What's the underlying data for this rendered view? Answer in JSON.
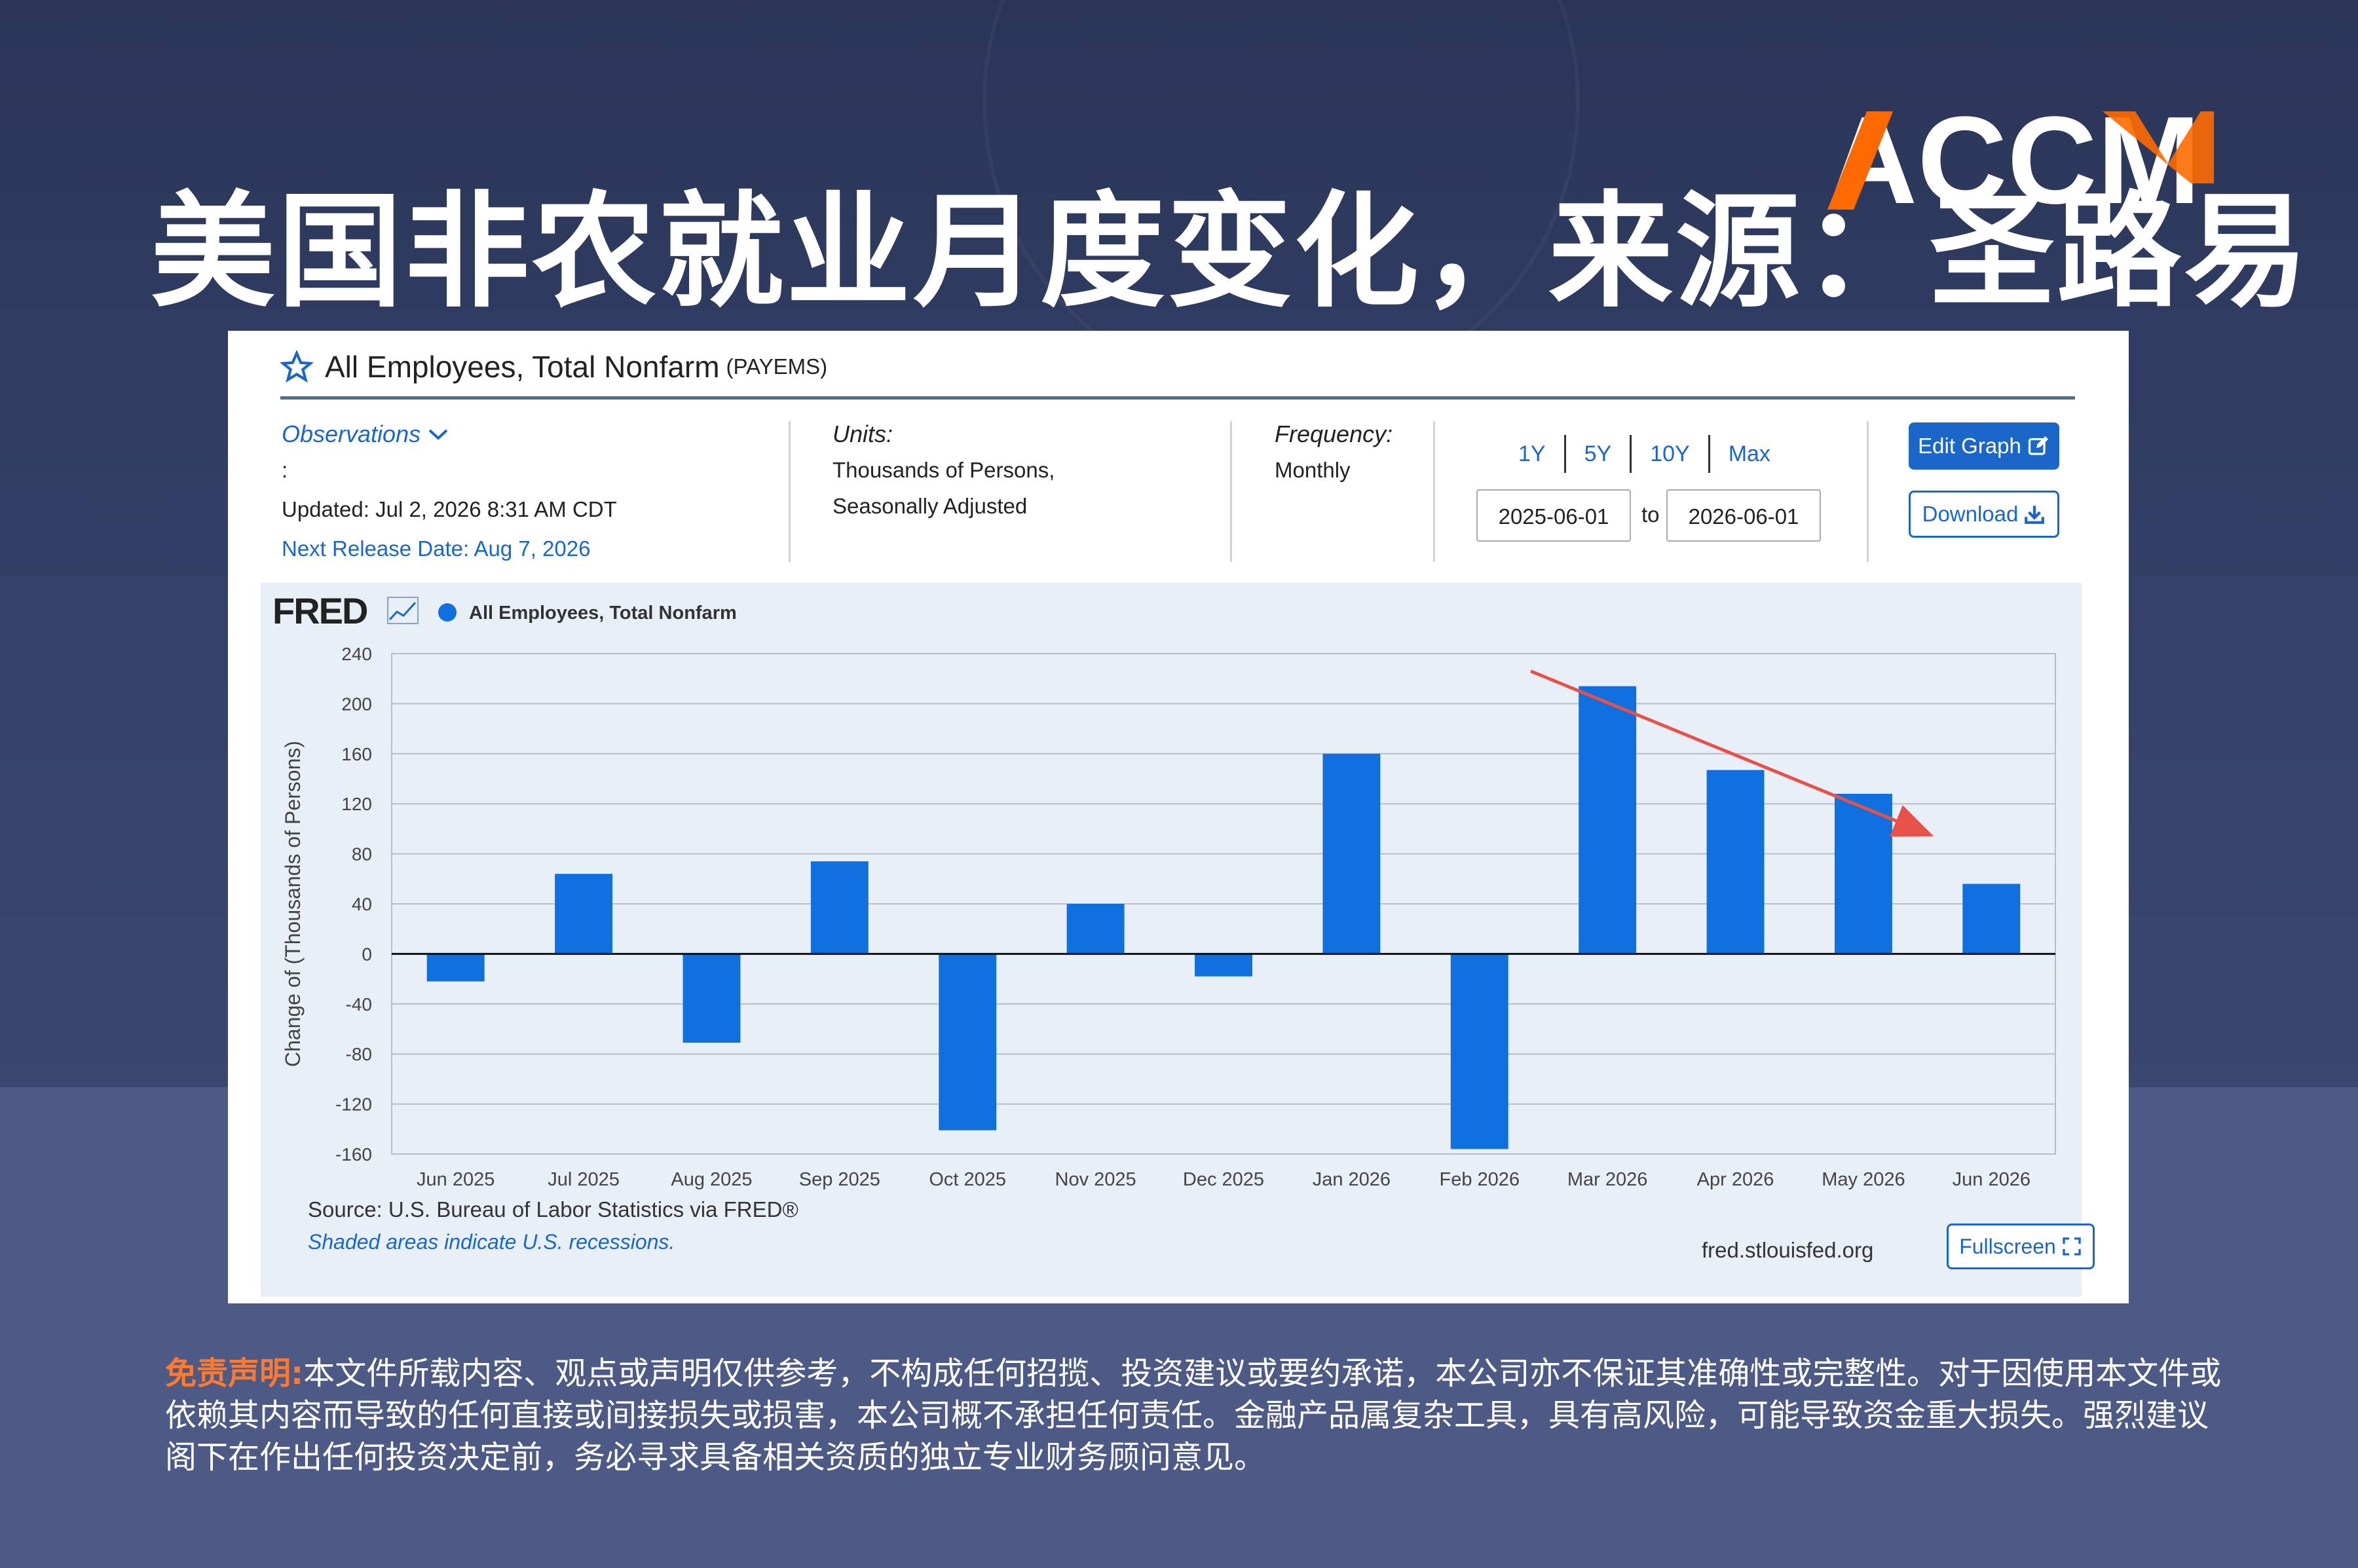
{
  "headline": "美国非农就业月度变化，来源：圣路易",
  "logo_text": "ACCM",
  "colors": {
    "accent": "#1a66c9",
    "bar": "#1170e0",
    "logo_orange": "#ff6a00",
    "arrow": "#e8504a",
    "disclaimer_label": "#ff7a2f"
  },
  "series_header": {
    "title": "All Employees, Total Nonfarm",
    "code": "(PAYEMS)",
    "star_icon": "star-outline-icon"
  },
  "observations": {
    "label": "Observations",
    "colon": ":",
    "updated": "Updated: Jul 2, 2026 8:31 AM CDT",
    "next_release": "Next Release Date: Aug 7, 2026"
  },
  "units": {
    "label": "Units:",
    "line1": "Thousands of Persons,",
    "line2": "Seasonally Adjusted"
  },
  "frequency": {
    "label": "Frequency:",
    "value": "Monthly"
  },
  "range": {
    "buttons": [
      "1Y",
      "5Y",
      "10Y",
      "Max"
    ],
    "start": "2025-06-01",
    "to": "to",
    "end": "2026-06-01"
  },
  "actions": {
    "edit": "Edit Graph",
    "download": "Download",
    "fullscreen": "Fullscreen"
  },
  "fred": {
    "brand": "FRED",
    "source": "Source: U.S. Bureau of Labor Statistics via FRED®",
    "shaded": "Shaded areas indicate U.S. recessions.",
    "url": "fred.stlouisfed.org"
  },
  "chart_data": {
    "type": "bar",
    "title": "",
    "legend": "All Employees, Total Nonfarm",
    "legend_position": "top-left",
    "ylabel": "Change of (Thousands of Persons)",
    "xlabel": "",
    "categories": [
      "Jun 2025",
      "Jul 2025",
      "Aug 2025",
      "Sep 2025",
      "Oct 2025",
      "Nov 2025",
      "Dec 2025",
      "Jan 2026",
      "Feb 2026",
      "Mar 2026",
      "Apr 2026",
      "May 2026",
      "Jun 2026"
    ],
    "values": [
      -22,
      64,
      -71,
      74,
      -141,
      40,
      -18,
      160,
      -156,
      214,
      147,
      128,
      56
    ],
    "ylim": [
      -160,
      240
    ],
    "yticks": [
      240,
      200,
      160,
      120,
      80,
      40,
      0,
      -40,
      -80,
      -120,
      -160
    ],
    "grid": true,
    "annotation": "red downward trend arrow from Mar 2026 to Jun 2026"
  },
  "disclaimer": {
    "label": "免责声明:",
    "text": "本文件所载内容、观点或声明仅供参考，不构成任何招揽、投资建议或要约承诺，本公司亦不保证其准确性或完整性。对于因使用本文件或依赖其内容而导致的任何直接或间接损失或损害，本公司概不承担任何责任。金融产品属复杂工具，具有高风险，可能导致资金重大损失。强烈建议阁下在作出任何投资决定前，务必寻求具备相关资质的独立专业财务顾问意见。"
  }
}
